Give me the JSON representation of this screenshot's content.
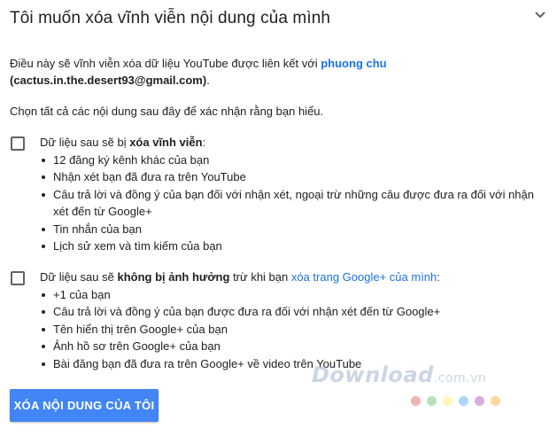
{
  "header": {
    "title": "Tôi muốn xóa vĩnh viễn nội dung của mình",
    "collapse_icon": "chevron-down-icon"
  },
  "intro": {
    "text_before": "Điều này sẽ vĩnh viễn xóa dữ liệu YouTube được liên kết với ",
    "account_name": "phuong chu",
    "email": "(cactus.in.the.desert93@gmail.com)",
    "text_after": "."
  },
  "instruction": "Chọn tất cả các nội dung sau đây để xác nhận rằng bạn hiểu.",
  "section_deleted": {
    "lead_before": "Dữ liệu sau sẽ bị ",
    "lead_bold": "xóa vĩnh viễn",
    "lead_after": ":",
    "checked": false,
    "items": [
      "12 đăng ký kênh khác của bạn",
      "Nhận xét bạn đã đưa ra trên YouTube",
      "Câu trả lời và đồng ý của bạn đối với nhận xét, ngoại trừ những câu được đưa ra đối với nhận xét đến từ Google+",
      "Tin nhắn của bạn",
      "Lịch sử xem và tìm kiếm của bạn"
    ]
  },
  "section_kept": {
    "lead_before": "Dữ liệu sau sẽ ",
    "lead_bold": "không bị ảnh hưởng",
    "lead_middle": " trừ khi bạn ",
    "lead_link": "xóa trang Google+ của mình",
    "lead_after": ":",
    "checked": false,
    "items": [
      "+1 của bạn",
      "Câu trả lời và đồng ý của bạn được đưa ra đối với nhận xét đến từ Google+",
      "Tên hiển thị trên Google+ của bạn",
      "Ảnh hồ sơ trên Google+ của bạn",
      "Bài đăng bạn đã đưa ra trên Google+ về video trên YouTube"
    ]
  },
  "button": {
    "label": "XÓA NỘI DUNG CỦA TÔI"
  },
  "watermark": {
    "text": "Download",
    "suffix": ".com.vn",
    "dot_colors": [
      "#e57373",
      "#81c784",
      "#fff176",
      "#64b5f6",
      "#ba68c8",
      "#ffb74d"
    ]
  },
  "colors": {
    "link": "#1a73e8",
    "button": "#4285f4",
    "text": "#212121"
  }
}
